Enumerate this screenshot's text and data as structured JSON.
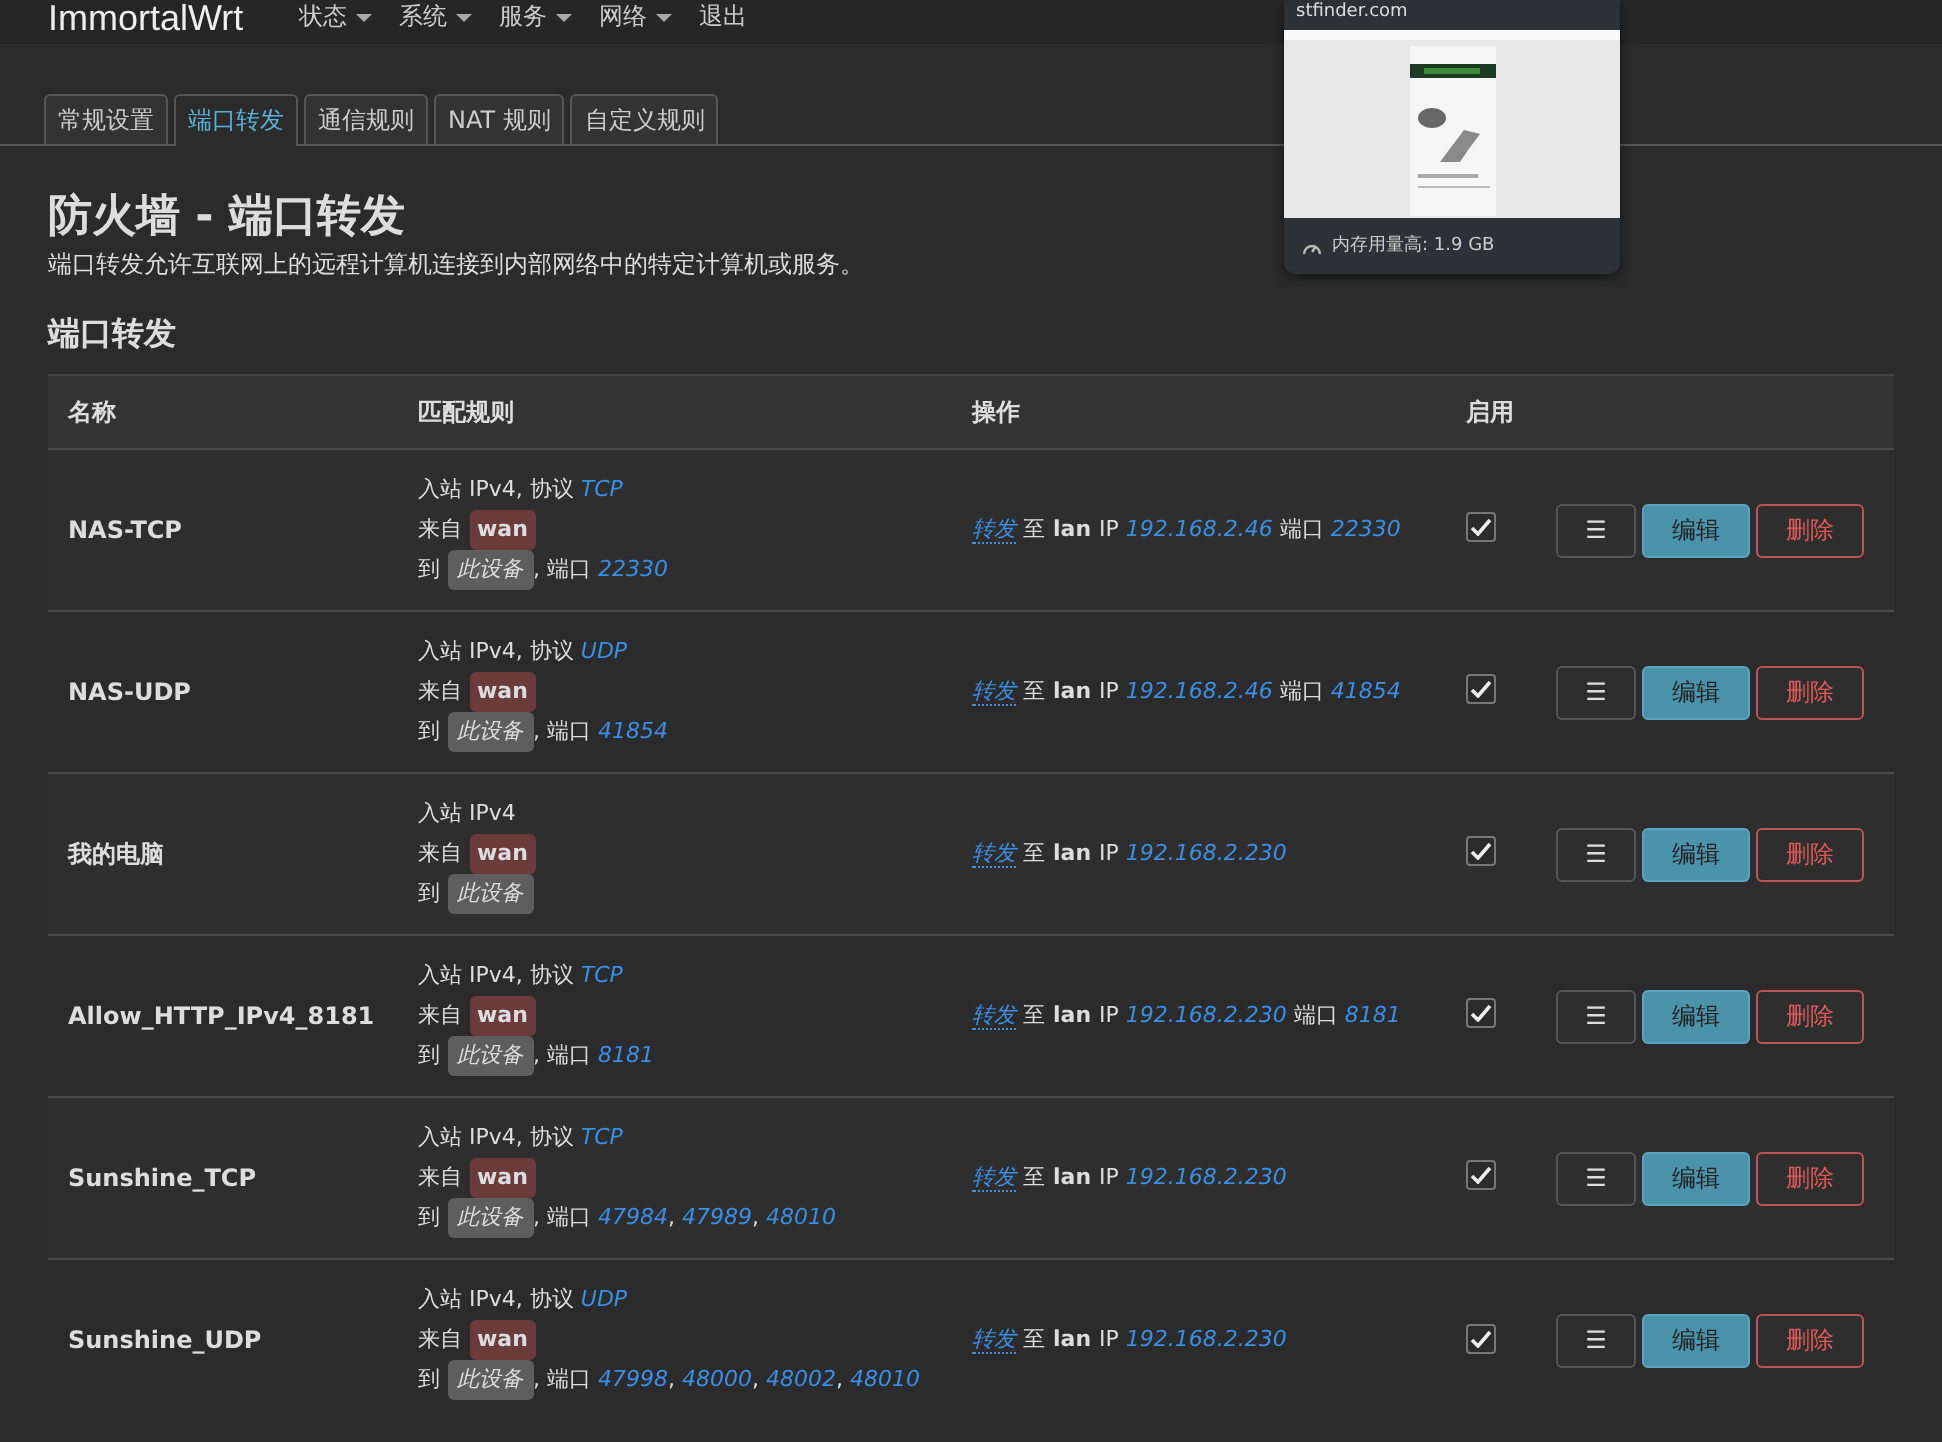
{
  "navbar": {
    "brand": "ImmortalWrt",
    "menus": [
      {
        "label": "状态",
        "dropdown": true
      },
      {
        "label": "系统",
        "dropdown": true
      },
      {
        "label": "服务",
        "dropdown": true
      },
      {
        "label": "网络",
        "dropdown": true
      },
      {
        "label": "退出",
        "dropdown": false
      }
    ]
  },
  "tabs": [
    {
      "label": "常规设置",
      "selected": false
    },
    {
      "label": "端口转发",
      "selected": true
    },
    {
      "label": "通信规则",
      "selected": false
    },
    {
      "label": "NAT 规则",
      "selected": false
    },
    {
      "label": "自定义规则",
      "selected": false
    }
  ],
  "title": "防火墙 - 端口转发",
  "description": "端口转发允许互联网上的远程计算机连接到内部网络中的特定计算机或服务。",
  "section_title": "端口转发",
  "table": {
    "columns": [
      "名称",
      "匹配规则",
      "操作",
      "启用"
    ],
    "separator": ",",
    "rows": [
      {
        "name": "NAS-TCP",
        "match": {
          "inbound": "入站 IPv4, 协议",
          "protocol": "TCP",
          "from_label": "来自",
          "zone": "wan",
          "to_label": "到",
          "device": "此设备",
          "port_label": ", 端口",
          "ports": [
            "22330"
          ]
        },
        "action": {
          "verb": "转发",
          "to": "至",
          "zone": "lan",
          "ip_label": "IP",
          "ip": "192.168.2.46",
          "port_label": "端口",
          "port": "22330"
        },
        "enabled": true,
        "buttons": [
          "☰",
          "编辑",
          "删除"
        ]
      },
      {
        "name": "NAS-UDP",
        "match": {
          "inbound": "入站 IPv4, 协议",
          "protocol": "UDP",
          "from_label": "来自",
          "zone": "wan",
          "to_label": "到",
          "device": "此设备",
          "port_label": ", 端口",
          "ports": [
            "41854"
          ]
        },
        "action": {
          "verb": "转发",
          "to": "至",
          "zone": "lan",
          "ip_label": "IP",
          "ip": "192.168.2.46",
          "port_label": "端口",
          "port": "41854"
        },
        "enabled": true,
        "buttons": [
          "☰",
          "编辑",
          "删除"
        ]
      },
      {
        "name": "我的电脑",
        "match": {
          "inbound": "入站 IPv4",
          "from_label": "来自",
          "zone": "wan",
          "to_label": "到",
          "device": "此设备"
        },
        "action": {
          "verb": "转发",
          "to": "至",
          "zone": "lan",
          "ip_label": "IP",
          "ip": "192.168.2.230"
        },
        "enabled": true,
        "buttons": [
          "☰",
          "编辑",
          "删除"
        ]
      },
      {
        "name": "Allow_HTTP_IPv4_8181",
        "match": {
          "inbound": "入站 IPv4, 协议",
          "protocol": "TCP",
          "from_label": "来自",
          "zone": "wan",
          "to_label": "到",
          "device": "此设备",
          "port_label": ", 端口",
          "ports": [
            "8181"
          ]
        },
        "action": {
          "verb": "转发",
          "to": "至",
          "zone": "lan",
          "ip_label": "IP",
          "ip": "192.168.2.230",
          "port_label": "端口",
          "port": "8181"
        },
        "enabled": true,
        "buttons": [
          "☰",
          "编辑",
          "删除"
        ]
      },
      {
        "name": "Sunshine_TCP",
        "match": {
          "inbound": "入站 IPv4, 协议",
          "protocol": "TCP",
          "from_label": "来自",
          "zone": "wan",
          "to_label": "到",
          "device": "此设备",
          "port_label": ", 端口",
          "ports": [
            "47984",
            "47989",
            "48010"
          ]
        },
        "action": {
          "verb": "转发",
          "to": "至",
          "zone": "lan",
          "ip_label": "IP",
          "ip": "192.168.2.230"
        },
        "enabled": true,
        "buttons": [
          "☰",
          "编辑",
          "删除"
        ]
      },
      {
        "name": "Sunshine_UDP",
        "match": {
          "inbound": "入站 IPv4, 协议",
          "protocol": "UDP",
          "from_label": "来自",
          "zone": "wan",
          "to_label": "到",
          "device": "此设备",
          "port_label": ", 端口",
          "ports": [
            "47998",
            "48000",
            "48002",
            "48010"
          ]
        },
        "action": {
          "verb": "转发",
          "to": "至",
          "zone": "lan",
          "ip_label": "IP",
          "ip": "192.168.2.230"
        },
        "enabled": true,
        "buttons": [
          "☰",
          "编辑",
          "删除"
        ]
      }
    ]
  },
  "tab_preview": {
    "title": "stfinder.com",
    "memory": "内存用量高: 1.9 GB"
  }
}
